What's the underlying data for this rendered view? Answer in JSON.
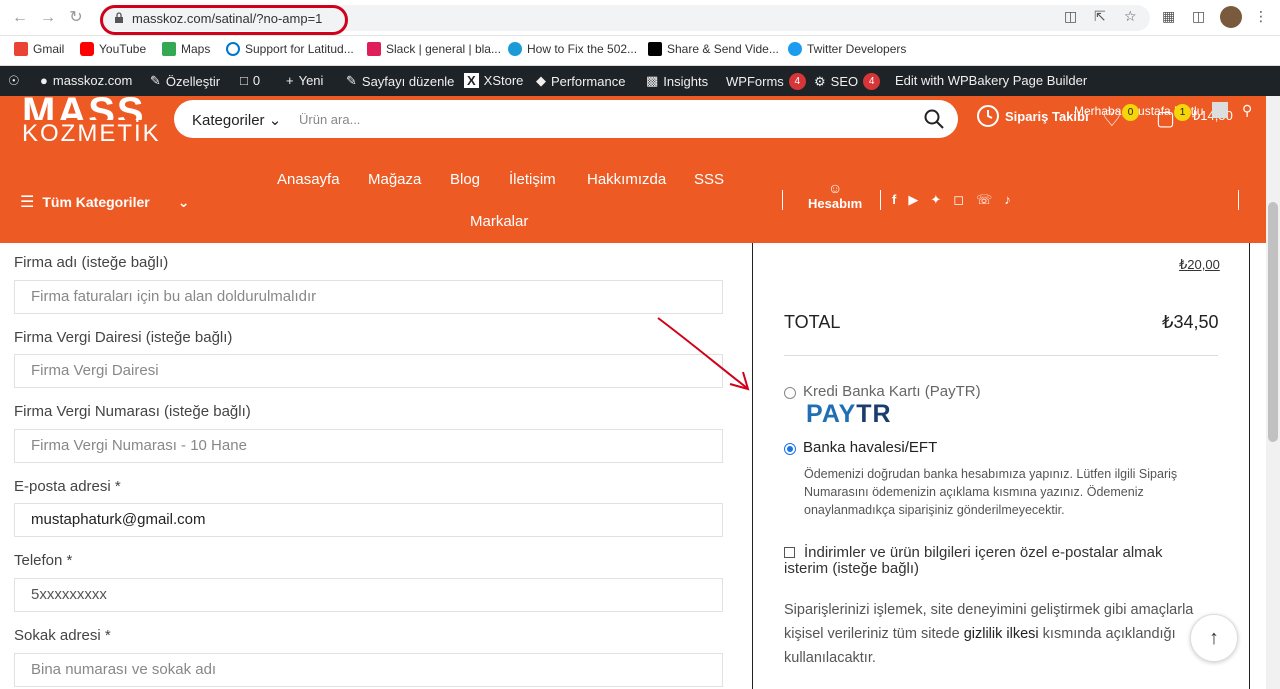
{
  "browser": {
    "url": "masskoz.com/satinal/?no-amp=1",
    "bookmarks": [
      "Gmail",
      "YouTube",
      "Maps",
      "Support for Latitud...",
      "Slack | general | bla...",
      "How to Fix the 502...",
      "Share & Send Vide...",
      "Twitter Developers"
    ]
  },
  "wpbar": {
    "site": "masskoz.com",
    "customize": "Özelleştir",
    "comments": "0",
    "new": "Yeni",
    "edit_page": "Sayfayı düzenle",
    "xstore": "XStore",
    "performance": "Performance",
    "insights": "Insights",
    "wpforms": "WPForms",
    "wpforms_count": "4",
    "seo": "SEO",
    "seo_count": "4",
    "wpbakery": "Edit with WPBakery Page Builder"
  },
  "header": {
    "logo_top": "MASS",
    "logo_bottom": "KOZMETİK",
    "search_category": "Kategoriler",
    "search_placeholder": "Ürün ara...",
    "order_tracking": "Sipariş Takibi",
    "greeting": "Merhaba, Mustafa Mutlu",
    "wishlist_count": "0",
    "cart_count": "1",
    "cart_total": "₺14,50",
    "all_categories": "Tüm Kategoriler",
    "menu": [
      "Anasayfa",
      "Mağaza",
      "Blog",
      "İletişim",
      "Hakkımızda",
      "SSS",
      "Markalar"
    ],
    "account": "Hesabım"
  },
  "form": {
    "fields": [
      {
        "label": "Firma adı (isteğe bağlı)",
        "placeholder": "Firma faturaları için bu alan doldurulmalıdır",
        "value": ""
      },
      {
        "label": "Firma Vergi Dairesi (isteğe bağlı)",
        "placeholder": "Firma Vergi Dairesi",
        "value": ""
      },
      {
        "label": "Firma Vergi Numarası (isteğe bağlı)",
        "placeholder": "Firma Vergi Numarası - 10 Hane",
        "value": ""
      },
      {
        "label": "E-posta adresi *",
        "placeholder": "",
        "value": "mustaphaturk@gmail.com"
      },
      {
        "label": "Telefon *",
        "placeholder": "",
        "value": "5xxxxxxxxx"
      },
      {
        "label": "Sokak adresi *",
        "placeholder": "Bina numarası ve sokak adı",
        "value": ""
      }
    ]
  },
  "order": {
    "shipping_price": "₺20,00",
    "total_label": "TOTAL",
    "total_value": "₺34,50",
    "payment_options": [
      {
        "label": "Kredi Banka Kartı (PayTR)",
        "selected": false
      },
      {
        "label": "Banka havalesi/EFT",
        "selected": true
      }
    ],
    "paytr_logo_a": "PAY",
    "paytr_logo_b": "TR",
    "bank_desc": "Ödemenizi doğrudan banka hesabımıza yapınız. Lütfen ilgili Sipariş Numarasını ödemenizin açıklama kısmına yazınız. Ödemeniz onaylanmadıkça siparişiniz gönderilmeyecektir.",
    "newsletter": "İndirimler ve ürün bilgileri içeren özel e-postalar almak isterim (isteğe bağlı)",
    "privacy_a": "Siparişlerinizi işlemek, site deneyimini geliştirmek gibi amaçlarla kişisel verileriniz tüm sitede ",
    "privacy_link": "gizlilik ilkesi",
    "privacy_b": " kısmında açıklandığı kullanılacaktır."
  },
  "colors": {
    "brand": "#ee5a24",
    "wpbar": "#1d2327",
    "paytr_a": "#1f6fb5",
    "paytr_b": "#1d3c6e",
    "annotation": "#d0021b"
  }
}
